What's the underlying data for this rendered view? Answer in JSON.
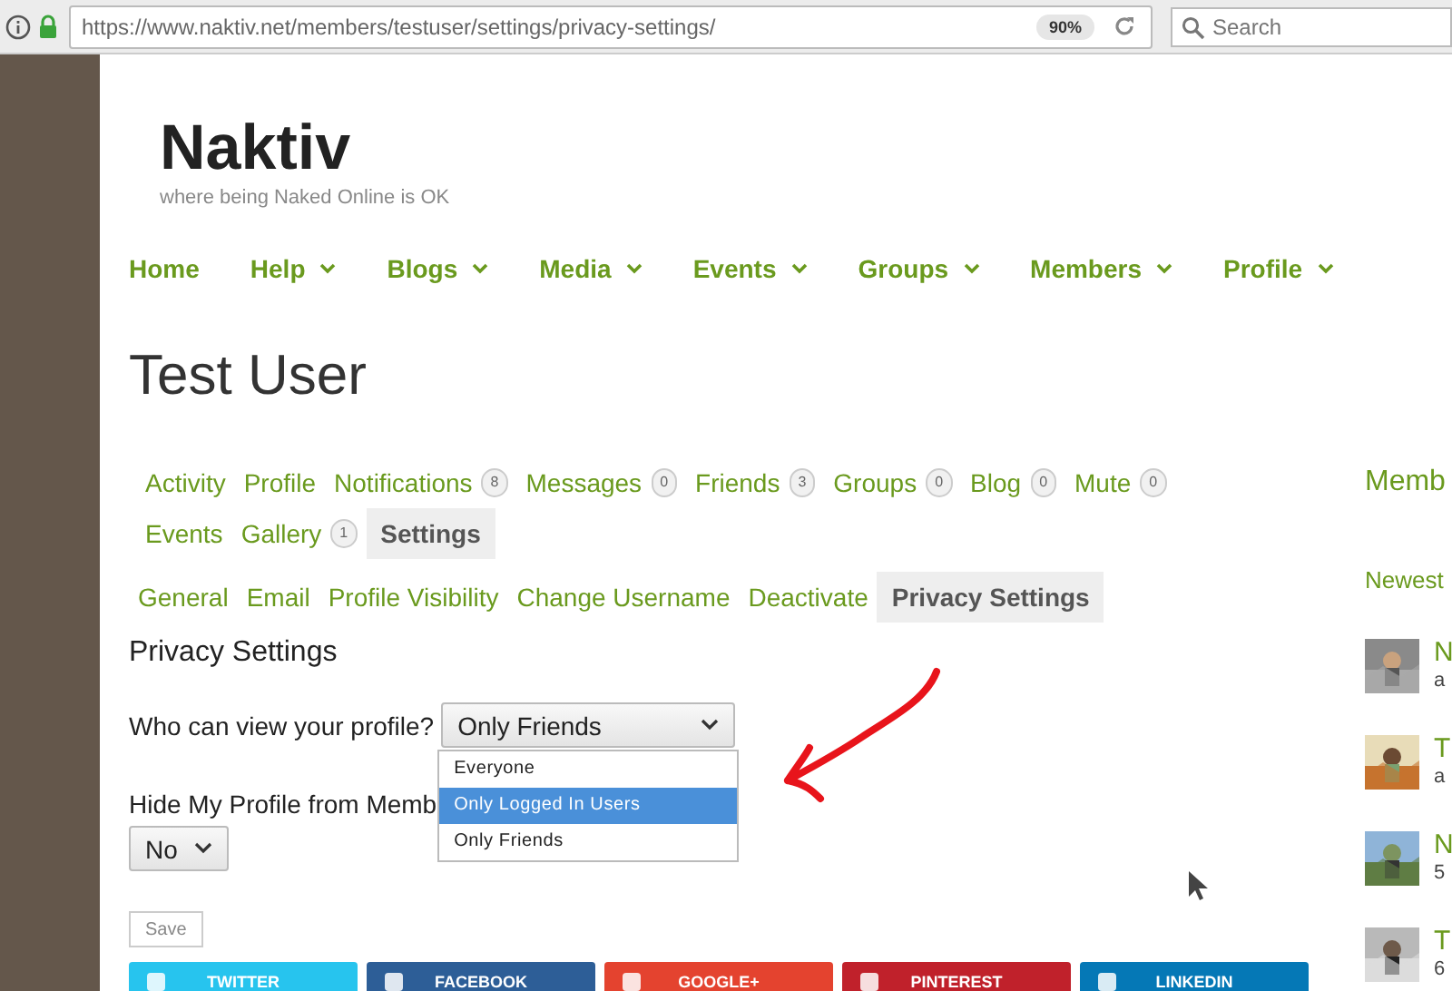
{
  "browser": {
    "url": "https://www.naktiv.net/members/testuser/settings/privacy-settings/",
    "zoom": "90%",
    "search": {
      "placeholder": "Search"
    }
  },
  "site": {
    "title": "Naktiv",
    "tagline": "where being Naked Online is OK"
  },
  "nav": [
    {
      "label": "Home",
      "has_menu": false
    },
    {
      "label": "Help",
      "has_menu": true
    },
    {
      "label": "Blogs",
      "has_menu": true
    },
    {
      "label": "Media",
      "has_menu": true
    },
    {
      "label": "Events",
      "has_menu": true
    },
    {
      "label": "Groups",
      "has_menu": true
    },
    {
      "label": "Members",
      "has_menu": true
    },
    {
      "label": "Profile",
      "has_menu": true
    }
  ],
  "page_title": "Test User",
  "tabs": [
    {
      "label": "Activity",
      "selected": false
    },
    {
      "label": "Profile",
      "selected": false
    },
    {
      "label": "Notifications",
      "count": "8",
      "selected": false
    },
    {
      "label": "Messages",
      "count": "0",
      "selected": false
    },
    {
      "label": "Friends",
      "count": "3",
      "selected": false
    },
    {
      "label": "Groups",
      "count": "0",
      "selected": false
    },
    {
      "label": "Blog",
      "count": "0",
      "selected": false
    },
    {
      "label": "Mute",
      "count": "0",
      "selected": false
    },
    {
      "label": "Events",
      "selected": false
    },
    {
      "label": "Gallery",
      "count": "1",
      "selected": false
    },
    {
      "label": "Settings",
      "selected": true
    }
  ],
  "subtabs": [
    {
      "label": "General",
      "selected": false
    },
    {
      "label": "Email",
      "selected": false
    },
    {
      "label": "Profile Visibility",
      "selected": false
    },
    {
      "label": "Change Username",
      "selected": false
    },
    {
      "label": "Deactivate",
      "selected": false
    },
    {
      "label": "Privacy Settings",
      "selected": true
    }
  ],
  "section_title": "Privacy Settings",
  "form": {
    "view_label": "Who can view your profile?",
    "view_value": "Only Friends",
    "view_options": [
      {
        "label": "Everyone",
        "selected": false
      },
      {
        "label": "Only Logged In Users",
        "selected": true
      },
      {
        "label": "Only Friends",
        "selected": false
      }
    ],
    "hide_label": "Hide My Profile from Memb",
    "hide_value": "No",
    "save": "Save"
  },
  "share": [
    {
      "label": "TWITTER",
      "color": "#27c4ee"
    },
    {
      "label": "FACEBOOK",
      "color": "#2d5e97"
    },
    {
      "label": "GOOGLE+",
      "color": "#e4432f"
    },
    {
      "label": "PINTEREST",
      "color": "#c0212b"
    },
    {
      "label": "LINKEDIN",
      "color": "#0578b6"
    }
  ],
  "sidebar": {
    "title": "Memb",
    "tab": "Newest",
    "members": [
      {
        "name": "N",
        "meta": "a"
      },
      {
        "name": "T",
        "meta": "a"
      },
      {
        "name": "N",
        "meta": "5"
      },
      {
        "name": "T",
        "meta": "6"
      }
    ]
  }
}
